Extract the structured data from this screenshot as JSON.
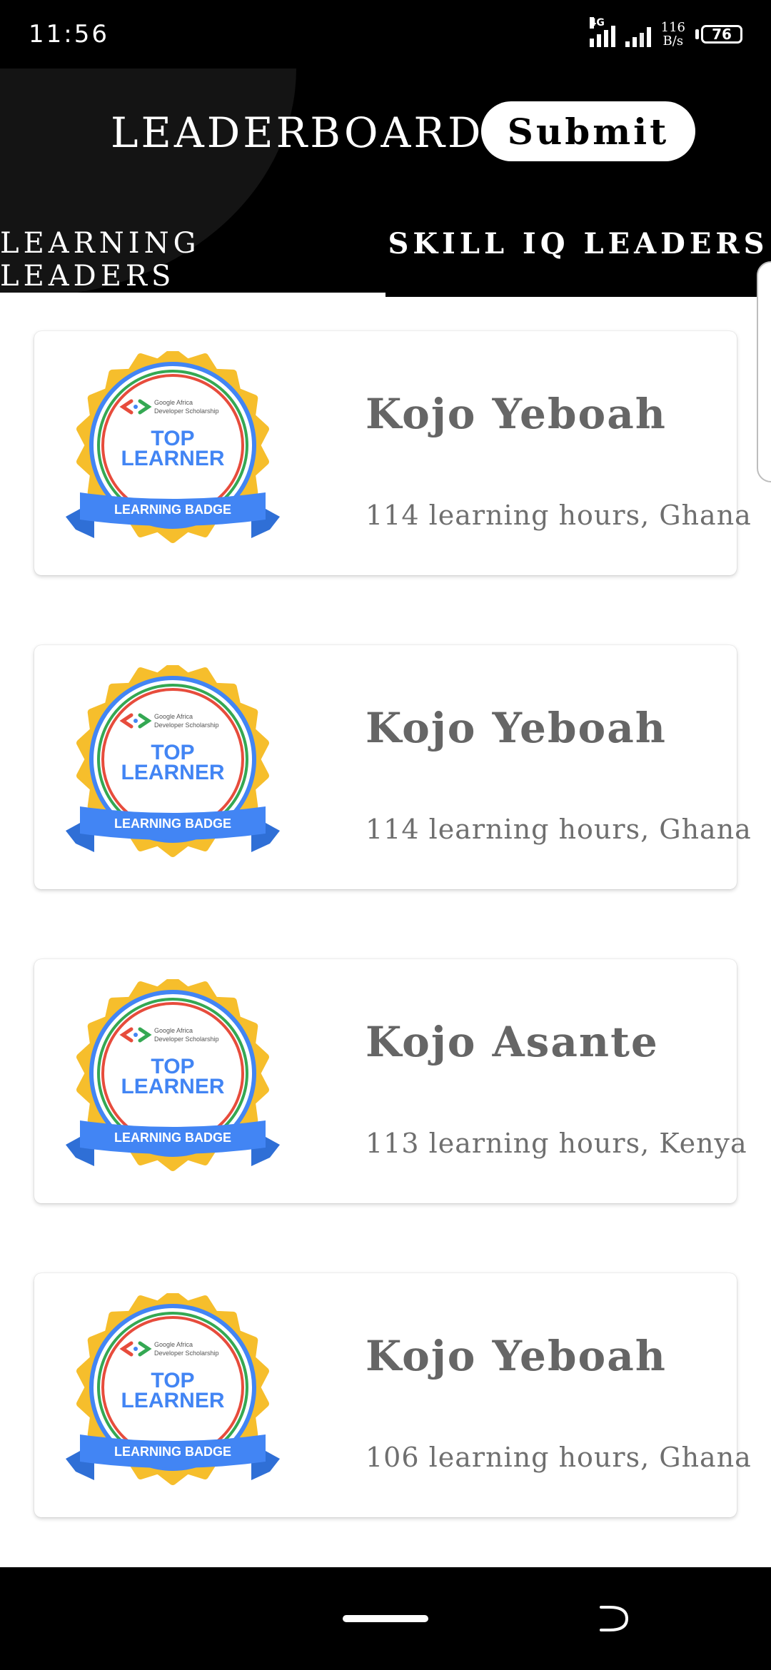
{
  "status_bar": {
    "time": "11:56",
    "network_type": "4G",
    "net_speed_value": "116",
    "net_speed_unit": "B/s",
    "battery": "76"
  },
  "header": {
    "title": "LEADERBOARD",
    "submit_label": "Submit"
  },
  "tabs": [
    {
      "label": "LEARNING LEADERS",
      "active": true
    },
    {
      "label": "SKILL IQ LEADERS",
      "active": false
    }
  ],
  "badge": {
    "org_line1": "Google Africa",
    "org_line2": "Developer Scholarship",
    "title_line1": "TOP",
    "title_line2": "LEARNER",
    "ribbon": "LEARNING BADGE"
  },
  "leaders": [
    {
      "name": "Kojo Yeboah",
      "detail": "114 learning hours, Ghana"
    },
    {
      "name": "Kojo Yeboah",
      "detail": "114 learning hours, Ghana"
    },
    {
      "name": "Kojo Asante",
      "detail": "113 learning hours, Kenya"
    },
    {
      "name": "Kojo Yeboah",
      "detail": "106 learning hours, Ghana"
    }
  ],
  "colors": {
    "header_bg": "#000000",
    "badge_gold": "#F6BE2C",
    "badge_blue": "#4285F4",
    "badge_red": "#E74C3C",
    "badge_green": "#34A853",
    "text_gray": "#666666"
  }
}
